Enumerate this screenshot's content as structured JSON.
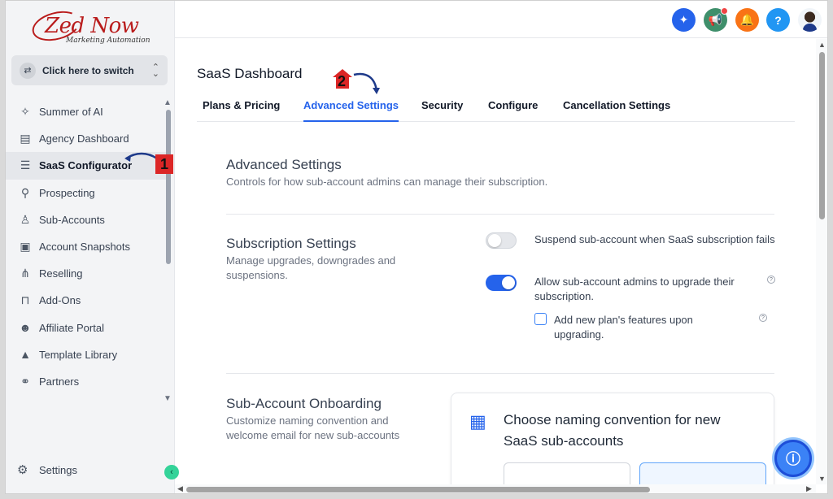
{
  "logo": {
    "main": "Zed Now",
    "sub": "Marketing Automation"
  },
  "switcher": {
    "label": "Click here to switch"
  },
  "sidebar": {
    "items": [
      {
        "label": "Summer of AI",
        "icon": "sparkle-icon"
      },
      {
        "label": "Agency Dashboard",
        "icon": "dashboard-icon"
      },
      {
        "label": "SaaS Configurator",
        "icon": "chart-bars-icon",
        "active": true
      },
      {
        "label": "Prospecting",
        "icon": "user-search-icon"
      },
      {
        "label": "Sub-Accounts",
        "icon": "user-icon"
      },
      {
        "label": "Account Snapshots",
        "icon": "snapshot-icon"
      },
      {
        "label": "Reselling",
        "icon": "network-icon"
      },
      {
        "label": "Add-Ons",
        "icon": "bag-icon"
      },
      {
        "label": "Affiliate Portal",
        "icon": "users-icon"
      },
      {
        "label": "Template Library",
        "icon": "shapes-icon"
      },
      {
        "label": "Partners",
        "icon": "handshake-icon"
      }
    ],
    "settings_label": "Settings"
  },
  "header": {
    "help_label": "?"
  },
  "page": {
    "title": "SaaS Dashboard"
  },
  "tabs": [
    {
      "label": "Plans & Pricing",
      "active": false
    },
    {
      "label": "Advanced Settings",
      "active": true
    },
    {
      "label": "Security",
      "active": false
    },
    {
      "label": "Configure",
      "active": false
    },
    {
      "label": "Cancellation Settings",
      "active": false
    }
  ],
  "advanced": {
    "title": "Advanced Settings",
    "desc": "Controls for how sub-account admins can manage their subscription."
  },
  "subscription": {
    "title": "Subscription Settings",
    "desc": "Manage upgrades, downgrades and suspensions.",
    "options": [
      {
        "label": "Suspend sub-account when SaaS subscription fails",
        "enabled": false
      },
      {
        "label": "Allow sub-account admins to upgrade their subscription.",
        "enabled": true
      }
    ],
    "checkbox_label": "Add new plan's features upon upgrading.",
    "checkbox_checked": false
  },
  "onboarding": {
    "title": "Sub-Account Onboarding",
    "desc": "Customize naming convention and welcome email for new sub-accounts",
    "card_title": "Choose naming convention for new SaaS sub-accounts"
  },
  "annotations": {
    "step1": "1",
    "step2": "2"
  },
  "colors": {
    "accent": "#2563eb",
    "annotation": "#dc2626"
  }
}
